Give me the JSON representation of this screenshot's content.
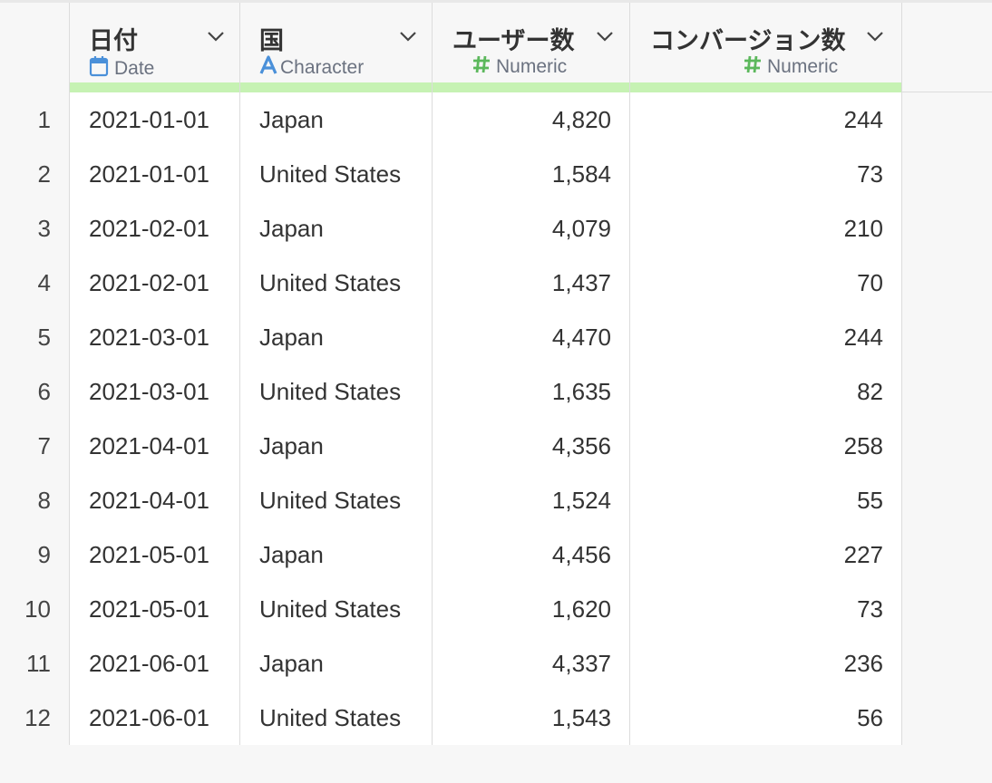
{
  "columns": [
    {
      "name": "日付",
      "type": "Date",
      "type_icon": "calendar-icon",
      "type_color": "#4a90d9",
      "align": "left"
    },
    {
      "name": "国",
      "type": "Character",
      "type_icon": "character-a-icon",
      "type_color": "#4a90d9",
      "align": "left"
    },
    {
      "name": "ユーザー数",
      "type": "Numeric",
      "type_icon": "numeric-hash-icon",
      "type_color": "#5cb85c",
      "align": "right"
    },
    {
      "name": "コンバージョン数",
      "type": "Numeric",
      "type_icon": "numeric-hash-icon",
      "type_color": "#5cb85c",
      "align": "right"
    }
  ],
  "header_bar_color": "#c6f2b3",
  "rows": [
    {
      "n": "1",
      "date": "2021-01-01",
      "country": "Japan",
      "users": "4,820",
      "conversions": "244"
    },
    {
      "n": "2",
      "date": "2021-01-01",
      "country": "United States",
      "users": "1,584",
      "conversions": "73"
    },
    {
      "n": "3",
      "date": "2021-02-01",
      "country": "Japan",
      "users": "4,079",
      "conversions": "210"
    },
    {
      "n": "4",
      "date": "2021-02-01",
      "country": "United States",
      "users": "1,437",
      "conversions": "70"
    },
    {
      "n": "5",
      "date": "2021-03-01",
      "country": "Japan",
      "users": "4,470",
      "conversions": "244"
    },
    {
      "n": "6",
      "date": "2021-03-01",
      "country": "United States",
      "users": "1,635",
      "conversions": "82"
    },
    {
      "n": "7",
      "date": "2021-04-01",
      "country": "Japan",
      "users": "4,356",
      "conversions": "258"
    },
    {
      "n": "8",
      "date": "2021-04-01",
      "country": "United States",
      "users": "1,524",
      "conversions": "55"
    },
    {
      "n": "9",
      "date": "2021-05-01",
      "country": "Japan",
      "users": "4,456",
      "conversions": "227"
    },
    {
      "n": "10",
      "date": "2021-05-01",
      "country": "United States",
      "users": "1,620",
      "conversions": "73"
    },
    {
      "n": "11",
      "date": "2021-06-01",
      "country": "Japan",
      "users": "4,337",
      "conversions": "236"
    },
    {
      "n": "12",
      "date": "2021-06-01",
      "country": "United States",
      "users": "1,543",
      "conversions": "56"
    }
  ]
}
